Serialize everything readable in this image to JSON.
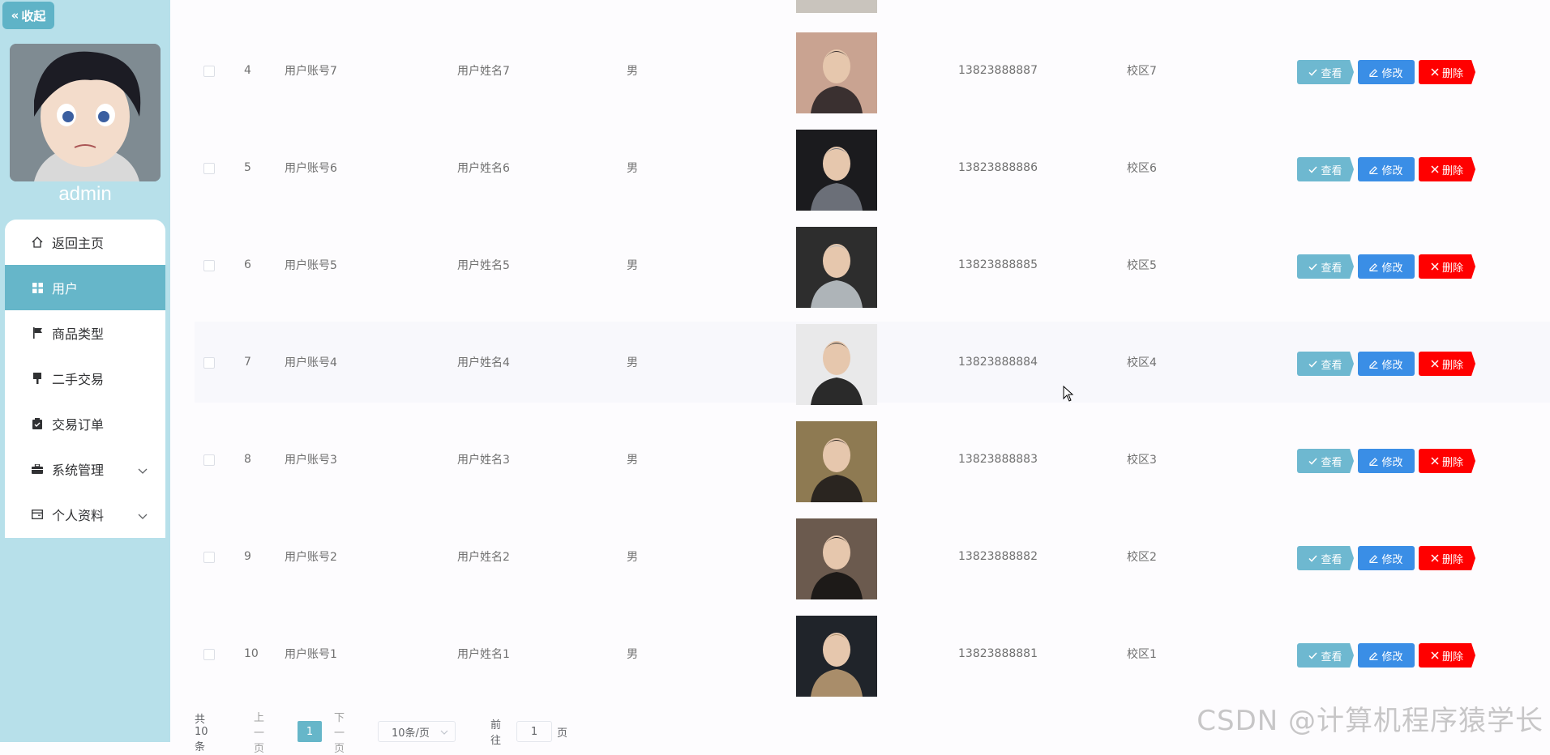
{
  "sidebar": {
    "collapse_label": "收起",
    "username": "admin",
    "menu": [
      {
        "label": "返回主页",
        "icon": "home-icon"
      },
      {
        "label": "用户",
        "icon": "grid-icon"
      },
      {
        "label": "商品类型",
        "icon": "flag-icon"
      },
      {
        "label": "二手交易",
        "icon": "brush-icon"
      },
      {
        "label": "交易订单",
        "icon": "clipboard-icon"
      },
      {
        "label": "系统管理",
        "icon": "briefcase-icon"
      },
      {
        "label": "个人资料",
        "icon": "wallet-icon"
      }
    ]
  },
  "table": {
    "rows": [
      {
        "index": "4",
        "account": "用户账号7",
        "name": "用户姓名7",
        "gender": "男",
        "phone": "13823888887",
        "campus": "校区7"
      },
      {
        "index": "5",
        "account": "用户账号6",
        "name": "用户姓名6",
        "gender": "男",
        "phone": "13823888886",
        "campus": "校区6"
      },
      {
        "index": "6",
        "account": "用户账号5",
        "name": "用户姓名5",
        "gender": "男",
        "phone": "13823888885",
        "campus": "校区5"
      },
      {
        "index": "7",
        "account": "用户账号4",
        "name": "用户姓名4",
        "gender": "男",
        "phone": "13823888884",
        "campus": "校区4"
      },
      {
        "index": "8",
        "account": "用户账号3",
        "name": "用户姓名3",
        "gender": "男",
        "phone": "13823888883",
        "campus": "校区3"
      },
      {
        "index": "9",
        "account": "用户账号2",
        "name": "用户姓名2",
        "gender": "男",
        "phone": "13823888882",
        "campus": "校区2"
      },
      {
        "index": "10",
        "account": "用户账号1",
        "name": "用户姓名1",
        "gender": "男",
        "phone": "13823888881",
        "campus": "校区1"
      }
    ],
    "actions": {
      "view": "查看",
      "edit": "修改",
      "delete": "删除"
    }
  },
  "pagination": {
    "total": "共 10 条",
    "prev": "上一页",
    "current_page": "1",
    "next": "下一页",
    "page_size": "10条/页",
    "goto_label": "前往",
    "goto_value": "1",
    "page_suffix": "页"
  },
  "watermark": "CSDN @计算机程序猿学长",
  "colors": {
    "sidebar_bg": "#b7e0ea",
    "active_menu": "#66b6c9",
    "view_btn": "#6eb8d0",
    "edit_btn": "#3a8ee6",
    "delete_btn": "#ff0000"
  }
}
